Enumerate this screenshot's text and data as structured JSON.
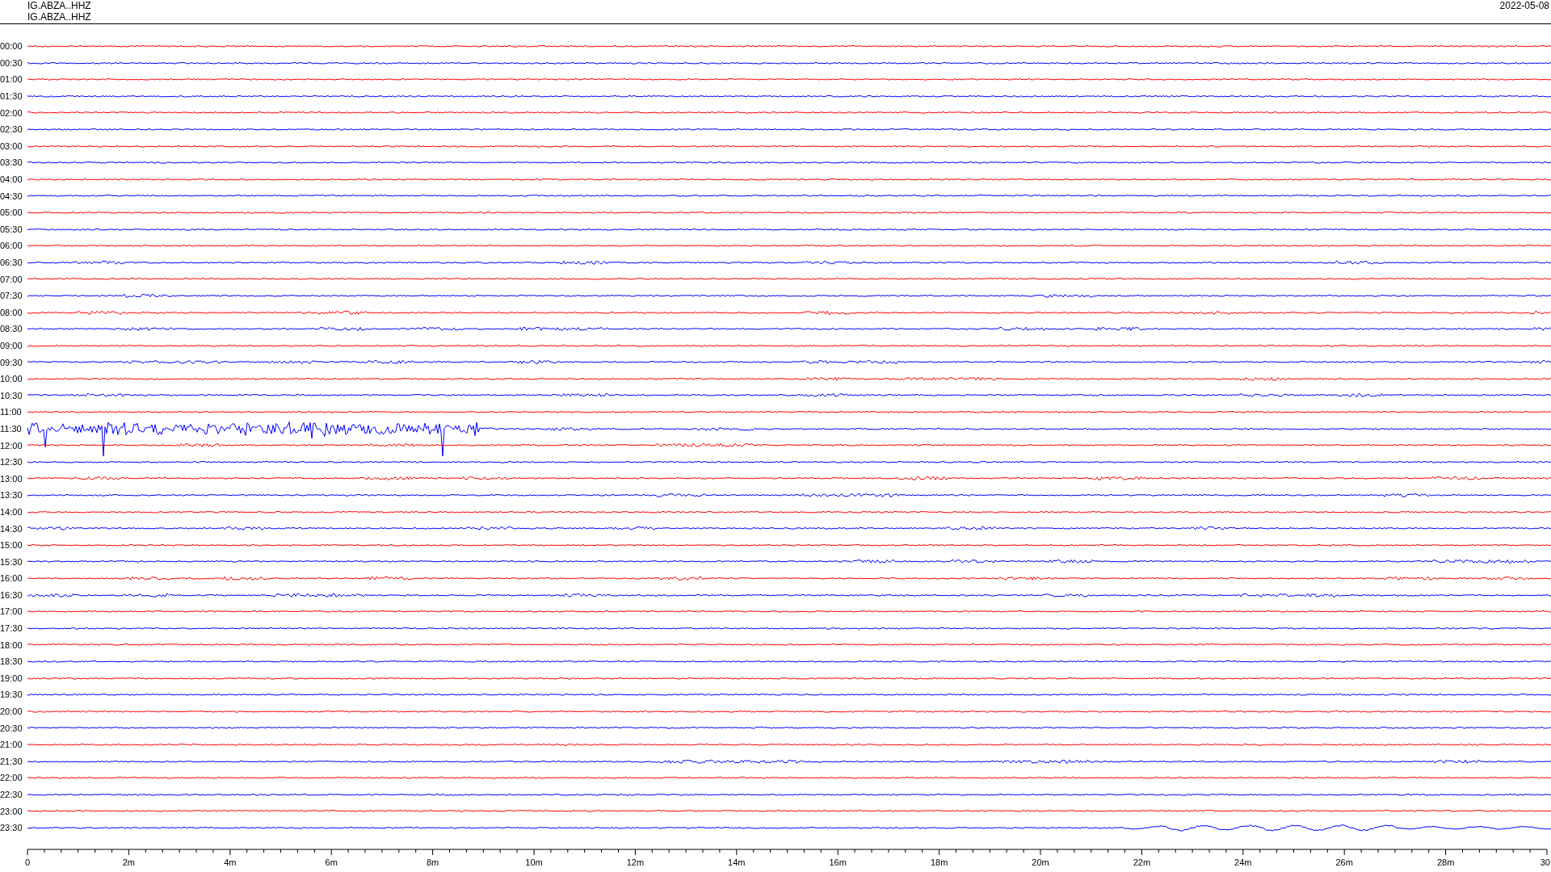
{
  "header": {
    "lines": [
      "IG.ABZA..HHZ",
      "IG.ABZA..HHZ"
    ],
    "date": "2022-05-08"
  },
  "rows": [
    {
      "time": "00:00",
      "color": "#ff0000",
      "kind": "quiet"
    },
    {
      "time": "00:30",
      "color": "#0000ff",
      "kind": "quiet"
    },
    {
      "time": "01:00",
      "color": "#ff0000",
      "kind": "quiet"
    },
    {
      "time": "01:30",
      "color": "#0000ff",
      "kind": "quiet"
    },
    {
      "time": "02:00",
      "color": "#ff0000",
      "kind": "quiet"
    },
    {
      "time": "02:30",
      "color": "#0000ff",
      "kind": "quiet"
    },
    {
      "time": "03:00",
      "color": "#ff0000",
      "kind": "quiet"
    },
    {
      "time": "03:30",
      "color": "#0000ff",
      "kind": "quiet"
    },
    {
      "time": "04:00",
      "color": "#ff0000",
      "kind": "quiet"
    },
    {
      "time": "04:30",
      "color": "#0000ff",
      "kind": "quiet"
    },
    {
      "time": "05:00",
      "color": "#ff0000",
      "kind": "quiet"
    },
    {
      "time": "05:30",
      "color": "#0000ff",
      "kind": "quiet"
    },
    {
      "time": "06:00",
      "color": "#ff0000",
      "kind": "quiet"
    },
    {
      "time": "06:30",
      "color": "#0000ff",
      "kind": "noisy"
    },
    {
      "time": "07:00",
      "color": "#ff0000",
      "kind": "quiet"
    },
    {
      "time": "07:30",
      "color": "#0000ff",
      "kind": "noisy"
    },
    {
      "time": "08:00",
      "color": "#ff0000",
      "kind": "noisy"
    },
    {
      "time": "08:30",
      "color": "#0000ff",
      "kind": "noisy"
    },
    {
      "time": "09:00",
      "color": "#ff0000",
      "kind": "quiet"
    },
    {
      "time": "09:30",
      "color": "#0000ff",
      "kind": "noisy"
    },
    {
      "time": "10:00",
      "color": "#ff0000",
      "kind": "noisy"
    },
    {
      "time": "10:30",
      "color": "#0000ff",
      "kind": "noisy"
    },
    {
      "time": "11:00",
      "color": "#ff0000",
      "kind": "quiet"
    },
    {
      "time": "11:30",
      "color": "#0000ff",
      "kind": "burst"
    },
    {
      "time": "12:00",
      "color": "#ff0000",
      "kind": "noisy"
    },
    {
      "time": "12:30",
      "color": "#0000ff",
      "kind": "quiet"
    },
    {
      "time": "13:00",
      "color": "#ff0000",
      "kind": "noisy"
    },
    {
      "time": "13:30",
      "color": "#0000ff",
      "kind": "noisy"
    },
    {
      "time": "14:00",
      "color": "#ff0000",
      "kind": "quiet"
    },
    {
      "time": "14:30",
      "color": "#0000ff",
      "kind": "noisy"
    },
    {
      "time": "15:00",
      "color": "#ff0000",
      "kind": "quiet"
    },
    {
      "time": "15:30",
      "color": "#0000ff",
      "kind": "noisy"
    },
    {
      "time": "16:00",
      "color": "#ff0000",
      "kind": "noisy"
    },
    {
      "time": "16:30",
      "color": "#0000ff",
      "kind": "noisy"
    },
    {
      "time": "17:00",
      "color": "#ff0000",
      "kind": "quiet"
    },
    {
      "time": "17:30",
      "color": "#0000ff",
      "kind": "quiet"
    },
    {
      "time": "18:00",
      "color": "#ff0000",
      "kind": "quiet"
    },
    {
      "time": "18:30",
      "color": "#0000ff",
      "kind": "quiet"
    },
    {
      "time": "19:00",
      "color": "#ff0000",
      "kind": "quiet"
    },
    {
      "time": "19:30",
      "color": "#0000ff",
      "kind": "quiet"
    },
    {
      "time": "20:00",
      "color": "#ff0000",
      "kind": "quiet"
    },
    {
      "time": "20:30",
      "color": "#0000ff",
      "kind": "quiet"
    },
    {
      "time": "21:00",
      "color": "#ff0000",
      "kind": "quiet"
    },
    {
      "time": "21:30",
      "color": "#0000ff",
      "kind": "noisy"
    },
    {
      "time": "22:00",
      "color": "#ff0000",
      "kind": "quiet"
    },
    {
      "time": "22:30",
      "color": "#0000ff",
      "kind": "quiet"
    },
    {
      "time": "23:00",
      "color": "#ff0000",
      "kind": "quiet"
    },
    {
      "time": "23:30",
      "color": "#0000ff",
      "kind": "swell"
    }
  ],
  "x_axis": {
    "ticks": [
      "0",
      "2m",
      "4m",
      "6m",
      "8m",
      "10m",
      "12m",
      "14m",
      "16m",
      "18m",
      "20m",
      "22m",
      "24m",
      "26m",
      "28m",
      "30"
    ]
  }
}
